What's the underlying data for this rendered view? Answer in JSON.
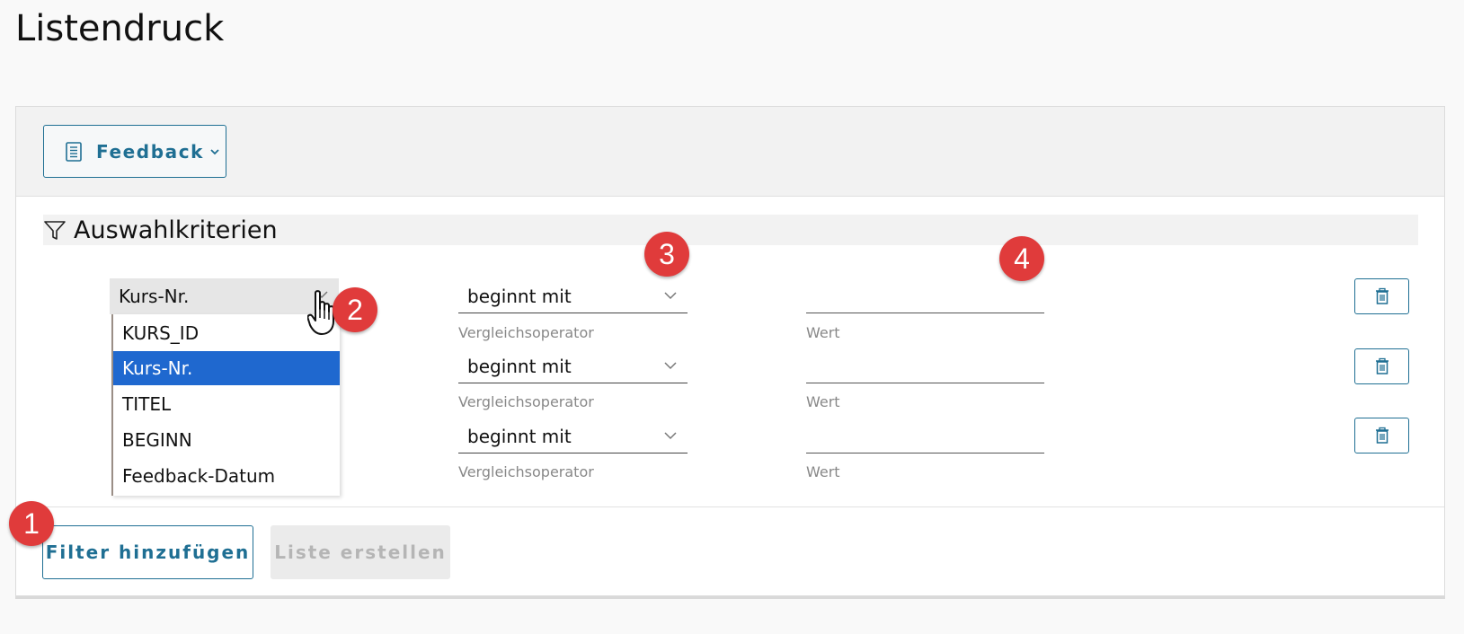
{
  "page": {
    "title": "Listendruck"
  },
  "report_selector": {
    "label": "Feedback",
    "icon": "document-list-icon"
  },
  "criteria": {
    "title": "Auswahlkriterien",
    "icon": "filter-funnel-icon",
    "rows": [
      {
        "field": "Kurs-Nr.",
        "operator": "beginnt mit",
        "operator_hint": "Vergleichsoperator",
        "value": "",
        "value_hint": "Wert"
      },
      {
        "field": "",
        "operator": "beginnt mit",
        "operator_hint": "Vergleichsoperator",
        "value": "",
        "value_hint": "Wert"
      },
      {
        "field": "",
        "operator": "beginnt mit",
        "operator_hint": "Vergleichsoperator",
        "value": "",
        "value_hint": "Wert"
      }
    ]
  },
  "field_dropdown": {
    "options": [
      "KURS_ID",
      "Kurs-Nr.",
      "TITEL",
      "BEGINN",
      "Feedback-Datum"
    ],
    "selected": "Kurs-Nr."
  },
  "actions": {
    "add_filter": "Filter hinzufügen",
    "create_list": "Liste erstellen"
  },
  "badges": [
    "1",
    "2",
    "3",
    "4"
  ],
  "colors": {
    "accent": "#1f6f93",
    "selection": "#1f68cf",
    "badge": "#e03b3b"
  }
}
